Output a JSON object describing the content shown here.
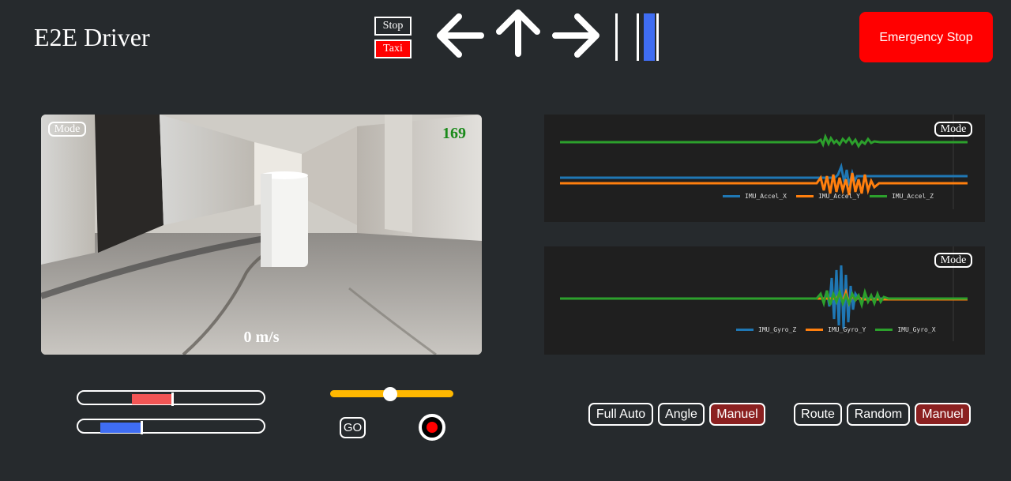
{
  "header": {
    "title": "E2E Driver",
    "stop_label": "Stop",
    "taxi_label": "Taxi",
    "emergency_label": "Emergency Stop"
  },
  "camera": {
    "mode_label": "Mode",
    "counter": "169",
    "speed": "0 m/s"
  },
  "accel_chart": {
    "mode_label": "Mode",
    "legend": [
      "IMU_Accel_X",
      "IMU_Accel_Y",
      "IMU_Accel_Z"
    ]
  },
  "gyro_chart": {
    "mode_label": "Mode",
    "legend": [
      "IMU_Gyro_Z",
      "IMU_Gyro_Y",
      "IMU_Gyro_X"
    ]
  },
  "controls": {
    "go_label": "GO",
    "slider_value": 0.49,
    "bar_red_value": 0.5,
    "bar_blue_value": 0.35
  },
  "mode_buttons": {
    "full_auto": "Full Auto",
    "angle": "Angle",
    "manuel_1": "Manuel",
    "route": "Route",
    "random": "Random",
    "manuel_2": "Manuel"
  },
  "colors": {
    "series_blue": "#1f77b4",
    "series_orange": "#ff7f0e",
    "series_green": "#2ca02c",
    "emergency_red": "#ff0000",
    "active_button": "#8b2020",
    "slider_yellow": "#ffb800"
  },
  "icons": [
    "arrow-left-icon",
    "arrow-up-icon",
    "arrow-right-icon",
    "record-icon"
  ]
}
